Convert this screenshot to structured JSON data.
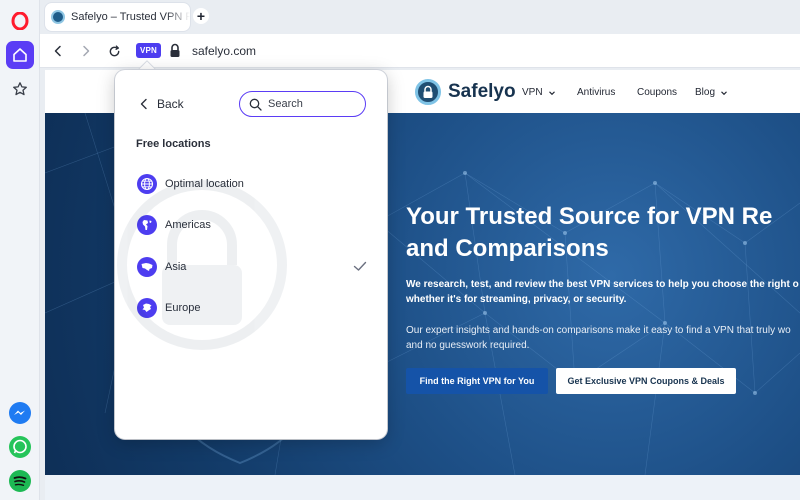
{
  "colors": {
    "accent": "#5b3df5",
    "vpn_badge": "#4d3df0",
    "hero_bg": "#1d4f86",
    "primary_button": "#1553a8"
  },
  "sidebar": {
    "items": [
      {
        "icon": "opera-logo-icon"
      },
      {
        "icon": "home-icon"
      },
      {
        "icon": "star-icon"
      },
      {
        "icon": "messenger-icon"
      },
      {
        "icon": "whatsapp-icon"
      },
      {
        "icon": "spotify-icon"
      }
    ]
  },
  "tabs": [
    {
      "title": "Safelyo – Trusted VPN Reviews",
      "icon": "safelyo-favicon"
    }
  ],
  "toolbar": {
    "vpn_badge": "VPN",
    "url": "safelyo.com"
  },
  "vpn_popup": {
    "back_label": "Back",
    "search_placeholder": "Search",
    "section_title": "Free locations",
    "locations": [
      {
        "label": "Optimal location",
        "icon": "globe-icon",
        "selected": false
      },
      {
        "label": "Americas",
        "icon": "americas-icon",
        "selected": false
      },
      {
        "label": "Asia",
        "icon": "asia-icon",
        "selected": true
      },
      {
        "label": "Europe",
        "icon": "europe-icon",
        "selected": false
      }
    ]
  },
  "site": {
    "brand": "Safelyo",
    "nav": [
      {
        "label": "VPN",
        "has_dropdown": true
      },
      {
        "label": "Antivirus",
        "has_dropdown": false
      },
      {
        "label": "Coupons",
        "has_dropdown": false
      },
      {
        "label": "Blog",
        "has_dropdown": true
      }
    ],
    "hero": {
      "title_line1": "Your Trusted Source for VPN Re",
      "title_line2": "and Comparisons",
      "subtitle_line1": "We research, test, and review the best VPN services to help you choose the right o",
      "subtitle_line2": "whether it's for streaming, privacy, or security.",
      "paragraph_line1": "Our expert insights and hands-on comparisons make it easy to find a VPN that truly wo",
      "paragraph_line2": "and no guesswork required.",
      "primary_button": "Find the Right VPN for You",
      "secondary_button": "Get Exclusive VPN Coupons & Deals"
    }
  }
}
